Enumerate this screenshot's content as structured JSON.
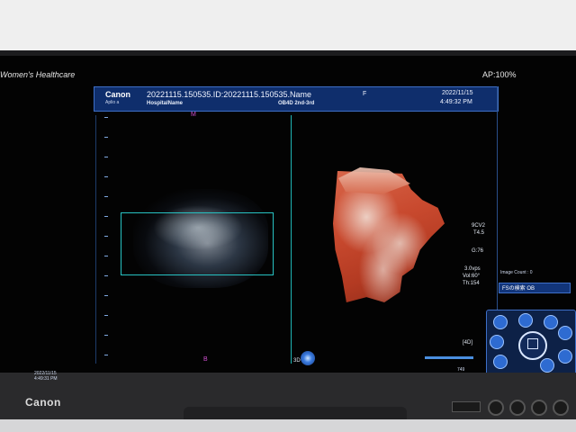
{
  "header": {
    "left_title": "Women's Healthcare",
    "ap_label": "AP:100%"
  },
  "patient_bar": {
    "logo": "Canon",
    "sub": "Aplio a",
    "name_line": "20221115.150535.ID:20221115.150535.Name",
    "hospital": "HospitalName",
    "sex": "F",
    "mode": "OB4D 2nd-3rd",
    "date": "2022/11/15",
    "time": "4:49:32 PM"
  },
  "left_view": {
    "marker_top": "M",
    "marker_bottom": "B",
    "badge": "3D"
  },
  "params": {
    "probe": "9CV2",
    "t": "T4.5",
    "g": "G:76",
    "vps": "3.0vps",
    "vol": "Vol:60°",
    "th": "Th:154"
  },
  "right_panel": {
    "image_count": "Image Count : 0",
    "selection_label": "FSの検索 OB"
  },
  "status": {
    "mode_4d": "[4D]",
    "gain_value": "749"
  },
  "screen_footer": {
    "date": "2022/11/15",
    "time": "4:49:31 PM"
  },
  "bezel": {
    "logo": "Canon"
  },
  "colors": {
    "accent": "#3e6fc7",
    "roi": "#27c2c2",
    "render": "#c8492e"
  }
}
